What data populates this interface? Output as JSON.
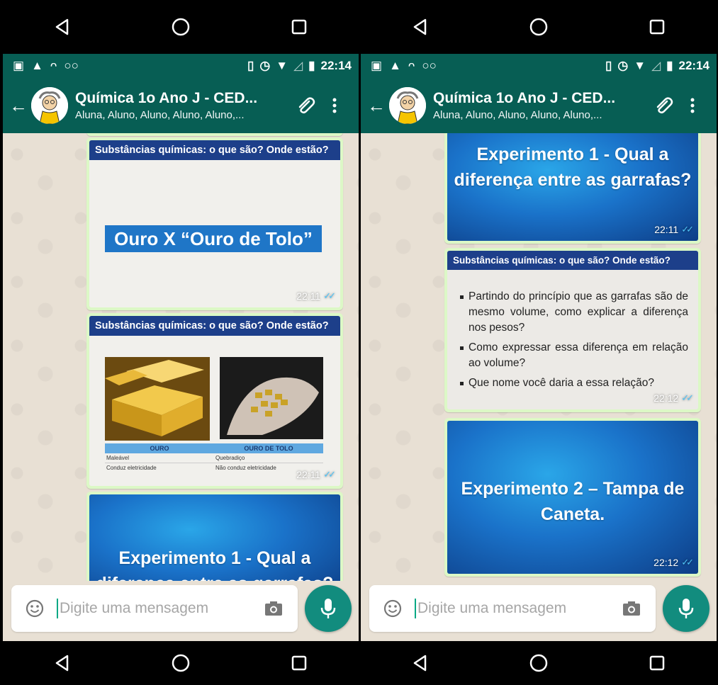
{
  "status_bar": {
    "time": "22:14"
  },
  "chat_header": {
    "title": "Química 1o Ano J - CED...",
    "subtitle": "Aluna, Aluno, Aluno, Aluno, Aluno,..."
  },
  "composer": {
    "placeholder": "Digite uma mensagem"
  },
  "left_messages": {
    "ouro_tolo": {
      "header": "Substâncias químicas: o que são? Onde estão?",
      "banner": "Ouro X “Ouro de Tolo”",
      "time": "22:11"
    },
    "ouro_table": {
      "header": "Substâncias químicas: o que são? Onde estão?",
      "col1": "OURO",
      "col2": "OURO DE TOLO",
      "row1_col1": "Maleável",
      "row1_col2": "Quebradiço",
      "row2_col1": "Conduz eletricidade",
      "row2_col2": "Não conduz eletricidade",
      "time": "22:11"
    },
    "experimento1_partial": {
      "line1": "Experimento 1 - Qual a",
      "line2": "diferença entre as garrafas?"
    }
  },
  "right_messages": {
    "experimento1": {
      "line1": "Experimento 1 - Qual a",
      "line2": "diferença entre as garrafas?",
      "time": "22:11"
    },
    "bullets": {
      "header": "Substâncias químicas: o que são? Onde estão?",
      "items": [
        "Partindo do princípio que as garrafas são de mesmo volume, como explicar a diferença nos pesos?",
        "Como expressar essa diferença em relação ao volume?",
        "Que nome você daria a essa relação?"
      ],
      "time": "22:12"
    },
    "experimento2": {
      "line1": "Experimento 2 – Tampa de",
      "line2": "Caneta.",
      "time": "22:12"
    }
  },
  "colors": {
    "header_green": "#075e54",
    "outgoing_bubble": "#dcf8c6",
    "mic_button": "#128c7e",
    "read_ticks": "#4fc3f7"
  }
}
